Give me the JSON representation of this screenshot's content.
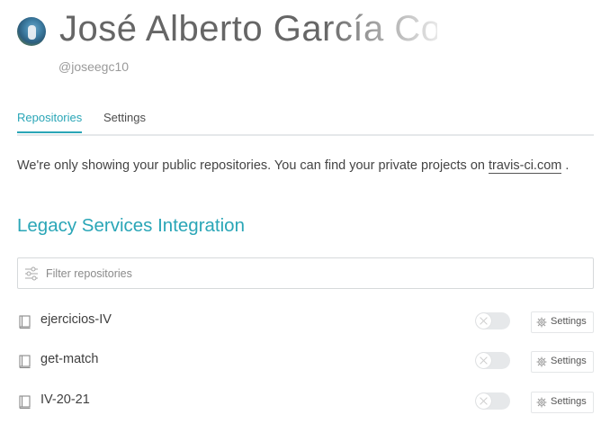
{
  "profile": {
    "name": "José Alberto García Co",
    "login": "@joseegc10"
  },
  "tabs": [
    {
      "label": "Repositories",
      "active": true
    },
    {
      "label": "Settings",
      "active": false
    }
  ],
  "notice": {
    "text": "We're only showing your public repositories. You can find your private projects on ",
    "link": "travis-ci.com",
    "end": " ."
  },
  "section": {
    "title": "Legacy Services Integration"
  },
  "filter": {
    "placeholder": "Filter repositories"
  },
  "repos": [
    {
      "name": "ejercicios-IV",
      "enabled": false,
      "settings_label": "Settings"
    },
    {
      "name": "get-match",
      "enabled": false,
      "settings_label": "Settings"
    },
    {
      "name": "IV-20-21",
      "enabled": false,
      "settings_label": "Settings"
    }
  ],
  "icons": {
    "filter": "sliders-icon",
    "repo": "book-icon",
    "settings": "gear-icon"
  },
  "colors": {
    "accent": "#2aa6b7",
    "toggle_off": "#e6e8ea"
  }
}
